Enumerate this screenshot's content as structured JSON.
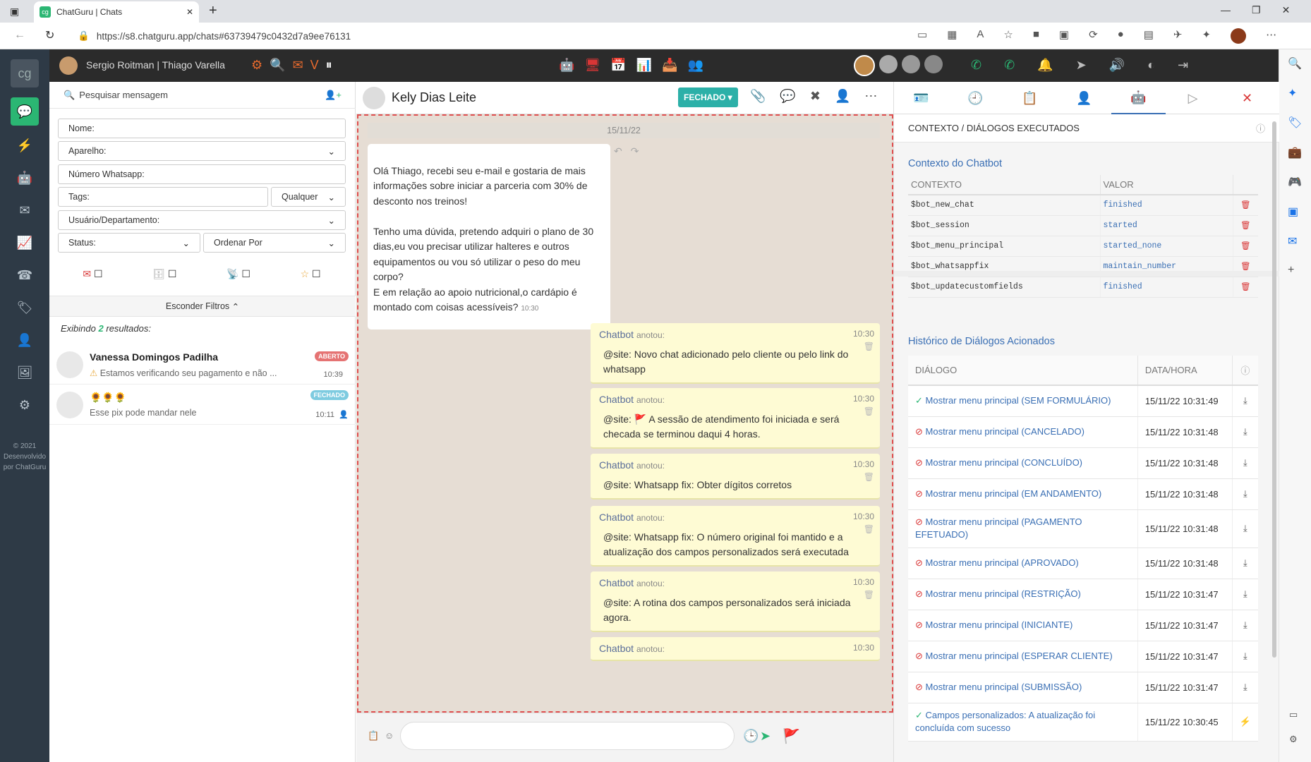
{
  "browser": {
    "tab_title": "ChatGuru | Chats",
    "url": "https://s8.chatguru.app/chats#63739479c0432d7a9ee76131"
  },
  "topbar": {
    "user": "Sergio Roitman | Thiago Varella"
  },
  "leftnav": {
    "copyright": "© 2021 Desenvolvido por ChatGuru"
  },
  "filters": {
    "search_placeholder": "Pesquisar mensagem",
    "nome": "Nome:",
    "aparelho": "Aparelho:",
    "numero": "Número Whatsapp:",
    "tags": "Tags:",
    "tags_mode": "Qualquer",
    "usuario": "Usuário/Departamento:",
    "status": "Status:",
    "ordenar": "Ordenar Por",
    "hide": "Esconder Filtros",
    "results_prefix": "Exibindo",
    "results_count": "2",
    "results_suffix": "resultados:"
  },
  "conversations": [
    {
      "name": "Vanessa Domingos Padilha",
      "badge": "ABERTO",
      "badge_color": "#e57373",
      "preview": "Estamos verificando seu pagamento e não ...",
      "time": "10:39"
    },
    {
      "name": "🌻🌻🌻",
      "badge": "FECHADO",
      "badge_color": "#7ecbe0",
      "preview": "Esse pix pode mandar nele",
      "time": "10:11"
    }
  ],
  "chat": {
    "contact": "Kely Dias Leite",
    "status_btn": "FECHADO",
    "date": "15/11/22",
    "incoming": {
      "text": "Olá Thiago, recebi seu e-mail e gostaria de mais informações sobre iniciar a parceria com 30% de desconto nos treinos!\n\nTenho uma dúvida, pretendo adquiri o plano de 30 dias,eu vou precisar utilizar halteres e outros equipamentos ou vou só utilizar o peso do meu corpo?\nE em relação ao apoio nutricional,o cardápio é montado com coisas acessíveis?",
      "time": "10:30"
    },
    "notes": [
      {
        "author": "Chatbot",
        "verb": "anotou:",
        "time": "10:30",
        "text": "@site: Novo chat adicionado pelo cliente ou pelo link do whatsapp"
      },
      {
        "author": "Chatbot",
        "verb": "anotou:",
        "time": "10:30",
        "text": "@site: 🚩 A sessão de atendimento foi iniciada e será checada se terminou daqui 4 horas."
      },
      {
        "author": "Chatbot",
        "verb": "anotou:",
        "time": "10:30",
        "text": "@site: Whatsapp fix: Obter dígitos corretos"
      },
      {
        "author": "Chatbot",
        "verb": "anotou:",
        "time": "10:30",
        "text": "@site: Whatsapp fix: O número original foi mantido e a atualização dos campos personalizados será executada"
      },
      {
        "author": "Chatbot",
        "verb": "anotou:",
        "time": "10:30",
        "text": "@site: A rotina dos campos personalizados será iniciada agora."
      },
      {
        "author": "Chatbot",
        "verb": "anotou:",
        "time": "10:30",
        "text": ""
      }
    ]
  },
  "right": {
    "section_title": "CONTEXTO / DIÁLOGOS EXECUTADOS",
    "ctx_title": "Contexto do Chatbot",
    "ctx_col1": "CONTEXTO",
    "ctx_col2": "VALOR",
    "ctx_rows": [
      [
        "$bot_new_chat",
        "finished"
      ],
      [
        "$bot_session",
        "started"
      ],
      [
        "$bot_menu_principal",
        "started_none"
      ],
      [
        "$bot_whatsappfix",
        "maintain_number"
      ],
      [
        "$bot_updatecustomfields",
        "finished"
      ]
    ],
    "hist_title": "Histórico de Diálogos Acionados",
    "hist_col1": "DIÁLOGO",
    "hist_col2": "DATA/HORA",
    "hist_rows": [
      {
        "ok": true,
        "name": "Mostrar menu principal (SEM FORMULÁRIO)",
        "dt": "15/11/22 10:31:49"
      },
      {
        "ok": false,
        "name": "Mostrar menu principal (CANCELADO)",
        "dt": "15/11/22 10:31:48"
      },
      {
        "ok": false,
        "name": "Mostrar menu principal (CONCLUÍDO)",
        "dt": "15/11/22 10:31:48"
      },
      {
        "ok": false,
        "name": "Mostrar menu principal (EM ANDAMENTO)",
        "dt": "15/11/22 10:31:48"
      },
      {
        "ok": false,
        "name": "Mostrar menu principal (PAGAMENTO EFETUADO)",
        "dt": "15/11/22 10:31:48"
      },
      {
        "ok": false,
        "name": "Mostrar menu principal (APROVADO)",
        "dt": "15/11/22 10:31:48"
      },
      {
        "ok": false,
        "name": "Mostrar menu principal (RESTRIÇÃO)",
        "dt": "15/11/22 10:31:47"
      },
      {
        "ok": false,
        "name": "Mostrar menu principal (INICIANTE)",
        "dt": "15/11/22 10:31:47"
      },
      {
        "ok": false,
        "name": "Mostrar menu principal (ESPERAR CLIENTE)",
        "dt": "15/11/22 10:31:47"
      },
      {
        "ok": false,
        "name": "Mostrar menu principal (SUBMISSÃO)",
        "dt": "15/11/22 10:31:47"
      },
      {
        "ok": true,
        "name": "Campos personalizados: A atualização foi concluída com sucesso",
        "dt": "15/11/22 10:30:45"
      }
    ]
  }
}
